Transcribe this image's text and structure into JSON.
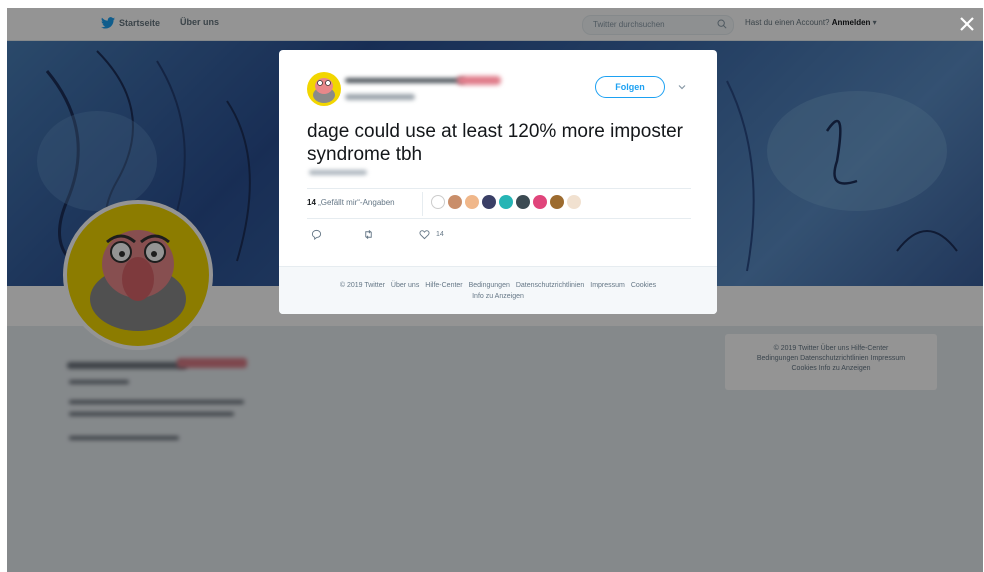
{
  "nav": {
    "home_label": "Startseite",
    "about_label": "Über uns",
    "search_placeholder": "Twitter durchsuchen",
    "account_prompt": "Hast du einen Account?",
    "login_label": "Anmelden",
    "login_caret": "▾"
  },
  "modal": {
    "follow_label": "Folgen",
    "tweet_text": "dage could use at least 120% more imposter syndrome tbh",
    "likes_count": "14",
    "likes_label": "„Gefällt mir“-Angaben",
    "like_count": "14",
    "footer_links": [
      "© 2019 Twitter",
      "Über uns",
      "Hilfe-Center",
      "Bedingungen",
      "Datenschutzrichtlinien",
      "Impressum",
      "Cookies",
      "Info zu Anzeigen"
    ]
  },
  "side_footer": {
    "lines": [
      "© 2019 Twitter  Über uns  Hilfe-Center",
      "Bedingungen  Datenschutzrichtlinien  Impressum",
      "Cookies  Info zu Anzeigen"
    ]
  },
  "colors": {
    "accent": "#1da1f2",
    "avatar_yellow": "#f2d600",
    "overlay": "rgba(0,0,0,0.42)"
  },
  "icons": [
    "twitter-bird-icon",
    "search-icon",
    "close-icon",
    "chevron-down-icon",
    "reply-icon",
    "retweet-icon",
    "heart-icon"
  ]
}
